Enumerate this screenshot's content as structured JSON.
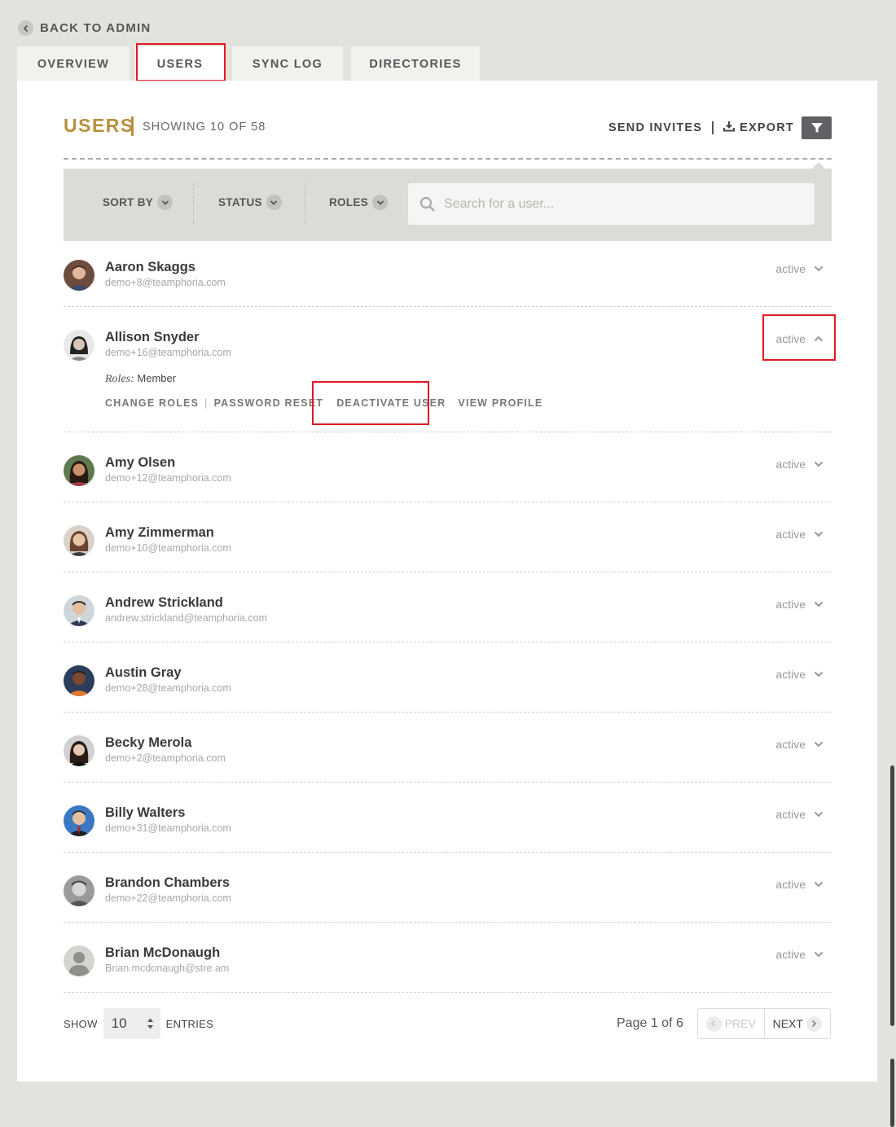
{
  "back_label": "BACK TO ADMIN",
  "tabs": [
    {
      "label": "OVERVIEW"
    },
    {
      "label": "USERS"
    },
    {
      "label": "SYNC LOG"
    },
    {
      "label": "DIRECTORIES"
    }
  ],
  "header": {
    "title": "USERS",
    "subtitle": "SHOWING 10 OF 58",
    "send_invites": "SEND INVITES",
    "export": "EXPORT"
  },
  "toolbar": {
    "sort_by": "SORT BY",
    "status": "STATUS",
    "roles": "ROLES",
    "search_placeholder": "Search for a user..."
  },
  "users": [
    {
      "name": "Aaron Skaggs",
      "email": "demo+8@teamphoria.com",
      "status": "active"
    },
    {
      "name": "Allison Snyder",
      "email": "demo+16@teamphoria.com",
      "status": "active",
      "roles_label": "Roles:",
      "roles_value": "Member"
    },
    {
      "name": "Amy Olsen",
      "email": "demo+12@teamphoria.com",
      "status": "active"
    },
    {
      "name": "Amy Zimmerman",
      "email": "demo+10@teamphoria.com",
      "status": "active"
    },
    {
      "name": "Andrew Strickland",
      "email": "andrew.strickland@teamphoria.com",
      "status": "active"
    },
    {
      "name": "Austin Gray",
      "email": "demo+28@teamphoria.com",
      "status": "active"
    },
    {
      "name": "Becky Merola",
      "email": "demo+2@teamphoria.com",
      "status": "active"
    },
    {
      "name": "Billy Walters",
      "email": "demo+31@teamphoria.com",
      "status": "active"
    },
    {
      "name": "Brandon Chambers",
      "email": "demo+22@teamphoria.com",
      "status": "active"
    },
    {
      "name": "Brian McDonaugh",
      "email": "Brian.mcdonaugh@stre.am",
      "status": "active"
    }
  ],
  "user_actions": {
    "change_roles": "CHANGE ROLES",
    "password_reset": "PASSWORD RESET",
    "deactivate": "DEACTIVATE USER",
    "view_profile": "VIEW PROFILE"
  },
  "footer": {
    "show": "SHOW",
    "entries_value": "10",
    "entries": "ENTRIES",
    "page_info": "Page 1 of 6",
    "prev": "PREV",
    "next": "NEXT"
  },
  "colors": {
    "accent": "#b78f3b",
    "highlight": "#e01a22",
    "background": "#e3e3de"
  }
}
